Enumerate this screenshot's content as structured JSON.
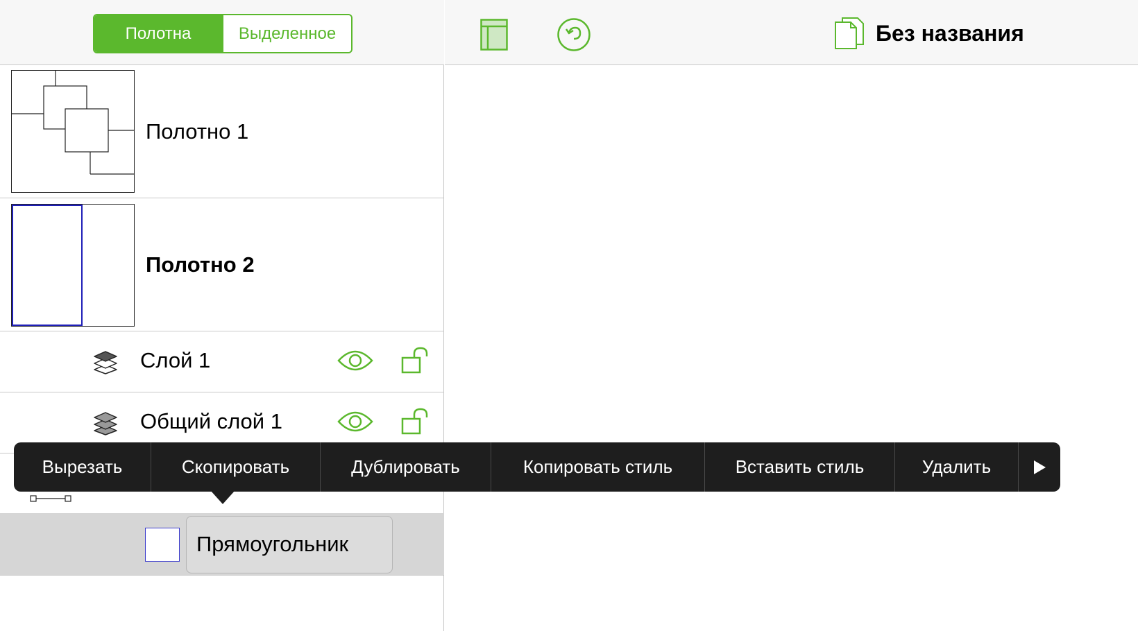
{
  "sidebar": {
    "segmented": {
      "canvases": "Полотна",
      "selection": "Выделенное"
    },
    "canvases": [
      {
        "label": "Полотно 1"
      },
      {
        "label": "Полотно 2"
      }
    ],
    "layers": [
      {
        "label": "Слой 1"
      },
      {
        "label": "Общий слой 1"
      }
    ],
    "object": {
      "label": "Прямоугольник"
    }
  },
  "toolbar": {
    "document_title": "Без названия"
  },
  "context_menu": {
    "items": [
      "Вырезать",
      "Скопировать",
      "Дублировать",
      "Копировать стиль",
      "Вставить стиль",
      "Удалить"
    ]
  },
  "colors": {
    "accent": "#5bb82d",
    "menu_bg": "#1e1e1e",
    "selection_blue": "#2a2acc"
  }
}
